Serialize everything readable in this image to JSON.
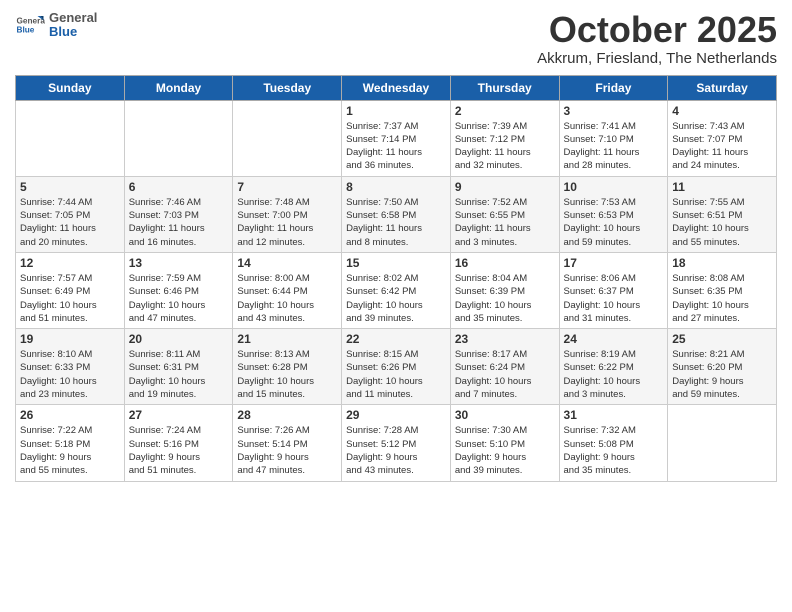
{
  "header": {
    "logo_general": "General",
    "logo_blue": "Blue",
    "month_title": "October 2025",
    "location": "Akkrum, Friesland, The Netherlands"
  },
  "weekdays": [
    "Sunday",
    "Monday",
    "Tuesday",
    "Wednesday",
    "Thursday",
    "Friday",
    "Saturday"
  ],
  "weeks": [
    [
      {
        "day": "",
        "info": ""
      },
      {
        "day": "",
        "info": ""
      },
      {
        "day": "",
        "info": ""
      },
      {
        "day": "1",
        "info": "Sunrise: 7:37 AM\nSunset: 7:14 PM\nDaylight: 11 hours\nand 36 minutes."
      },
      {
        "day": "2",
        "info": "Sunrise: 7:39 AM\nSunset: 7:12 PM\nDaylight: 11 hours\nand 32 minutes."
      },
      {
        "day": "3",
        "info": "Sunrise: 7:41 AM\nSunset: 7:10 PM\nDaylight: 11 hours\nand 28 minutes."
      },
      {
        "day": "4",
        "info": "Sunrise: 7:43 AM\nSunset: 7:07 PM\nDaylight: 11 hours\nand 24 minutes."
      }
    ],
    [
      {
        "day": "5",
        "info": "Sunrise: 7:44 AM\nSunset: 7:05 PM\nDaylight: 11 hours\nand 20 minutes."
      },
      {
        "day": "6",
        "info": "Sunrise: 7:46 AM\nSunset: 7:03 PM\nDaylight: 11 hours\nand 16 minutes."
      },
      {
        "day": "7",
        "info": "Sunrise: 7:48 AM\nSunset: 7:00 PM\nDaylight: 11 hours\nand 12 minutes."
      },
      {
        "day": "8",
        "info": "Sunrise: 7:50 AM\nSunset: 6:58 PM\nDaylight: 11 hours\nand 8 minutes."
      },
      {
        "day": "9",
        "info": "Sunrise: 7:52 AM\nSunset: 6:55 PM\nDaylight: 11 hours\nand 3 minutes."
      },
      {
        "day": "10",
        "info": "Sunrise: 7:53 AM\nSunset: 6:53 PM\nDaylight: 10 hours\nand 59 minutes."
      },
      {
        "day": "11",
        "info": "Sunrise: 7:55 AM\nSunset: 6:51 PM\nDaylight: 10 hours\nand 55 minutes."
      }
    ],
    [
      {
        "day": "12",
        "info": "Sunrise: 7:57 AM\nSunset: 6:49 PM\nDaylight: 10 hours\nand 51 minutes."
      },
      {
        "day": "13",
        "info": "Sunrise: 7:59 AM\nSunset: 6:46 PM\nDaylight: 10 hours\nand 47 minutes."
      },
      {
        "day": "14",
        "info": "Sunrise: 8:00 AM\nSunset: 6:44 PM\nDaylight: 10 hours\nand 43 minutes."
      },
      {
        "day": "15",
        "info": "Sunrise: 8:02 AM\nSunset: 6:42 PM\nDaylight: 10 hours\nand 39 minutes."
      },
      {
        "day": "16",
        "info": "Sunrise: 8:04 AM\nSunset: 6:39 PM\nDaylight: 10 hours\nand 35 minutes."
      },
      {
        "day": "17",
        "info": "Sunrise: 8:06 AM\nSunset: 6:37 PM\nDaylight: 10 hours\nand 31 minutes."
      },
      {
        "day": "18",
        "info": "Sunrise: 8:08 AM\nSunset: 6:35 PM\nDaylight: 10 hours\nand 27 minutes."
      }
    ],
    [
      {
        "day": "19",
        "info": "Sunrise: 8:10 AM\nSunset: 6:33 PM\nDaylight: 10 hours\nand 23 minutes."
      },
      {
        "day": "20",
        "info": "Sunrise: 8:11 AM\nSunset: 6:31 PM\nDaylight: 10 hours\nand 19 minutes."
      },
      {
        "day": "21",
        "info": "Sunrise: 8:13 AM\nSunset: 6:28 PM\nDaylight: 10 hours\nand 15 minutes."
      },
      {
        "day": "22",
        "info": "Sunrise: 8:15 AM\nSunset: 6:26 PM\nDaylight: 10 hours\nand 11 minutes."
      },
      {
        "day": "23",
        "info": "Sunrise: 8:17 AM\nSunset: 6:24 PM\nDaylight: 10 hours\nand 7 minutes."
      },
      {
        "day": "24",
        "info": "Sunrise: 8:19 AM\nSunset: 6:22 PM\nDaylight: 10 hours\nand 3 minutes."
      },
      {
        "day": "25",
        "info": "Sunrise: 8:21 AM\nSunset: 6:20 PM\nDaylight: 9 hours\nand 59 minutes."
      }
    ],
    [
      {
        "day": "26",
        "info": "Sunrise: 7:22 AM\nSunset: 5:18 PM\nDaylight: 9 hours\nand 55 minutes."
      },
      {
        "day": "27",
        "info": "Sunrise: 7:24 AM\nSunset: 5:16 PM\nDaylight: 9 hours\nand 51 minutes."
      },
      {
        "day": "28",
        "info": "Sunrise: 7:26 AM\nSunset: 5:14 PM\nDaylight: 9 hours\nand 47 minutes."
      },
      {
        "day": "29",
        "info": "Sunrise: 7:28 AM\nSunset: 5:12 PM\nDaylight: 9 hours\nand 43 minutes."
      },
      {
        "day": "30",
        "info": "Sunrise: 7:30 AM\nSunset: 5:10 PM\nDaylight: 9 hours\nand 39 minutes."
      },
      {
        "day": "31",
        "info": "Sunrise: 7:32 AM\nSunset: 5:08 PM\nDaylight: 9 hours\nand 35 minutes."
      },
      {
        "day": "",
        "info": ""
      }
    ]
  ]
}
